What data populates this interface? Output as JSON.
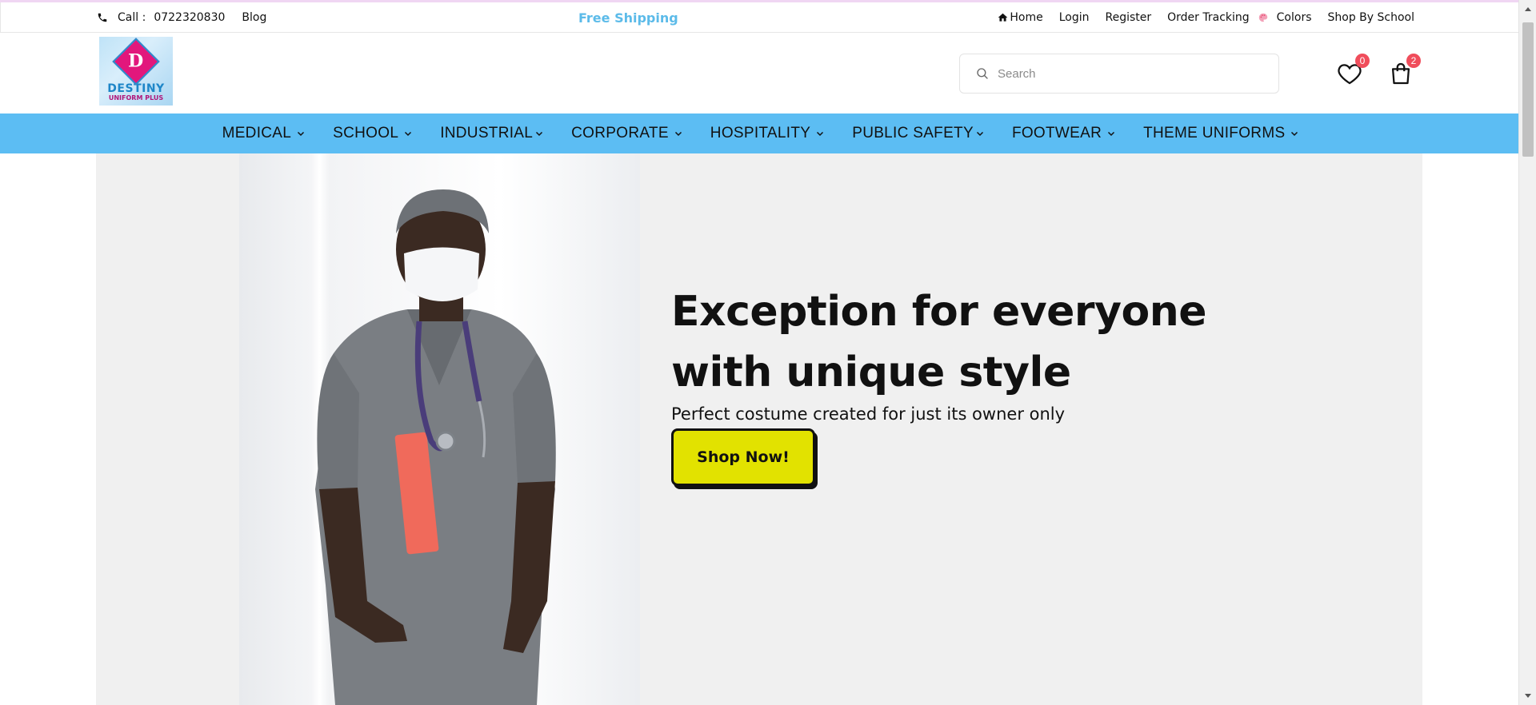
{
  "topbar": {
    "call_label": "Call :",
    "phone": "0722320830",
    "blog": "Blog",
    "promo": "Free Shipping",
    "links": {
      "home": "Home",
      "login": "Login",
      "register": "Register",
      "order_tracking": "Order Tracking",
      "colors": "Colors",
      "shop_by_school": "Shop By School"
    }
  },
  "header": {
    "logo_letter": "D",
    "logo_brand": "DESTINY",
    "logo_sub": "UNIFORM PLUS",
    "search_placeholder": "Search",
    "wishlist_count": "0",
    "cart_count": "2"
  },
  "nav": {
    "items": [
      "MEDICAL",
      "SCHOOL",
      "INDUSTRIAL",
      "CORPORATE",
      "HOSPITALITY",
      "PUBLIC SAFETY",
      "FOOTWEAR",
      "THEME UNIFORMS"
    ]
  },
  "hero": {
    "heading": "Exception for everyone with unique style",
    "tagline": "Perfect costume created for just its owner only",
    "button": "Shop Now!"
  },
  "colors": {
    "nav_bg": "#5cbdf3",
    "promo_text": "#5cbbe9",
    "button_bg": "#e2e200",
    "badge_bg": "#f04d5b",
    "hero_bg": "#f0f0f0"
  },
  "icons": [
    "phone-icon",
    "home-icon",
    "palette-icon",
    "search-icon",
    "heart-icon",
    "bag-icon",
    "chevron-down-icon"
  ]
}
